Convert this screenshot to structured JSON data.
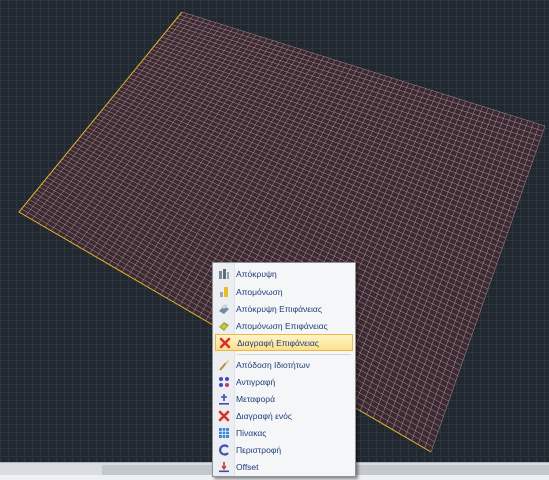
{
  "context_menu": {
    "items": [
      {
        "label": "Απόκρυψη",
        "icon": "hide-icon"
      },
      {
        "label": "Απομόνωση",
        "icon": "isolate-icon"
      },
      {
        "label": "Απόκρυψη Επιφάνειας",
        "icon": "hide-surface-icon"
      },
      {
        "label": "Απομόνωση Επιφάνειας",
        "icon": "isolate-surface-icon"
      },
      {
        "label": "Διαγραφή Επιφάνειας",
        "icon": "delete-surface-icon",
        "highlighted": true
      },
      {
        "label": "Απόδοση Ιδιοτήτων",
        "icon": "match-properties-icon"
      },
      {
        "label": "Αντιγραφή",
        "icon": "copy-icon"
      },
      {
        "label": "Μεταφορά",
        "icon": "move-icon"
      },
      {
        "label": "Διαγραφή ενός",
        "icon": "delete-one-icon"
      },
      {
        "label": "Πίνακας",
        "icon": "array-icon"
      },
      {
        "label": "Περιστροφή",
        "icon": "rotate-icon"
      },
      {
        "label": "Offset",
        "icon": "offset-icon"
      }
    ]
  },
  "colors": {
    "canvas_background": "#212830",
    "grid_line": "#2c3540",
    "mesh_line": "#c9a0a8",
    "selected_edge": "#e3b230",
    "menu_label": "#1e3d7a",
    "delete_red": "#d9302a"
  }
}
